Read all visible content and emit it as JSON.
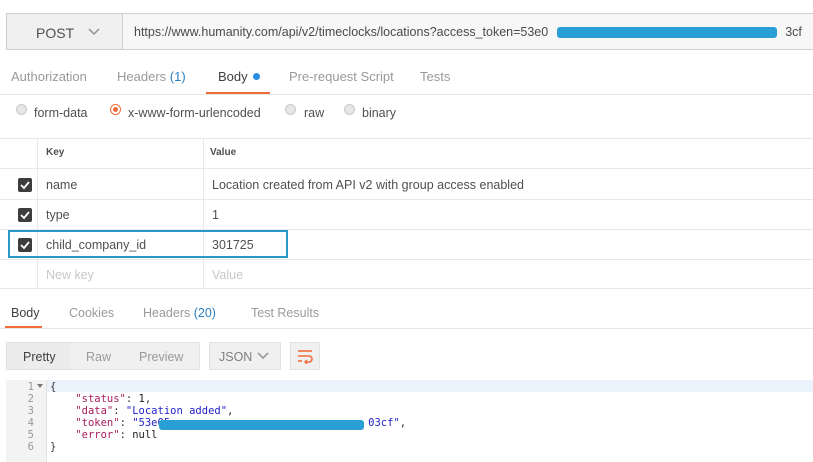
{
  "request": {
    "method": "POST",
    "url": "https://www.humanity.com/api/v2/timeclocks/locations?access_token=53e0",
    "url_tail": "3cf"
  },
  "request_tabs": [
    {
      "label": "Authorization"
    },
    {
      "label": "Headers",
      "count": "(1)"
    },
    {
      "label": "Body"
    },
    {
      "label": "Pre-request Script"
    },
    {
      "label": "Tests"
    }
  ],
  "body_types": [
    {
      "label": "form-data",
      "selected": false
    },
    {
      "label": "x-www-form-urlencoded",
      "selected": true
    },
    {
      "label": "raw",
      "selected": false
    },
    {
      "label": "binary",
      "selected": false
    }
  ],
  "params": {
    "headers": {
      "key": "Key",
      "value": "Value"
    },
    "rows": [
      {
        "key": "name",
        "value": "Location created from API v2 with group access enabled",
        "checked": true
      },
      {
        "key": "type",
        "value": "1",
        "checked": true
      },
      {
        "key": "child_company_id",
        "value": "301725",
        "checked": true
      }
    ],
    "new_key_placeholder": "New key",
    "new_value_placeholder": "Value"
  },
  "response_tabs": [
    {
      "label": "Body"
    },
    {
      "label": "Cookies"
    },
    {
      "label": "Headers",
      "count": "(20)"
    },
    {
      "label": "Test Results"
    }
  ],
  "response_format": {
    "buttons": [
      "Pretty",
      "Raw",
      "Preview"
    ],
    "language": "JSON"
  },
  "response_code": {
    "line_numbers": [
      "1",
      "2",
      "3",
      "4",
      "5",
      "6"
    ],
    "open": "{",
    "status_key": "\"status\"",
    "status_val": "1",
    "data_key": "\"data\"",
    "data_val": "\"Location added\"",
    "token_key": "\"token\"",
    "token_val_start": "\"53e05",
    "token_val_end": "03cf\"",
    "error_key": "\"error\"",
    "error_val": "null",
    "close": "}"
  },
  "colors": {
    "accent": "#f26b3a",
    "link": "#2a7fc1",
    "highlight_border": "#2b98c8",
    "redaction": "#2a9fd6"
  }
}
